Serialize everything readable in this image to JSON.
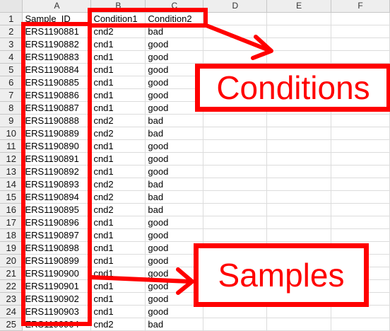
{
  "columns": [
    "A",
    "B",
    "C",
    "D",
    "E",
    "F"
  ],
  "header_row": [
    "Sample_ID",
    "Condition1",
    "Condition2",
    "",
    "",
    ""
  ],
  "rows": [
    {
      "n": "2",
      "a": "ERS1190881",
      "b": "cnd2",
      "c": "bad"
    },
    {
      "n": "3",
      "a": "ERS1190882",
      "b": "cnd1",
      "c": "good"
    },
    {
      "n": "4",
      "a": "ERS1190883",
      "b": "cnd1",
      "c": "good"
    },
    {
      "n": "5",
      "a": "ERS1190884",
      "b": "cnd1",
      "c": "good"
    },
    {
      "n": "6",
      "a": "ERS1190885",
      "b": "cnd1",
      "c": "good"
    },
    {
      "n": "7",
      "a": "ERS1190886",
      "b": "cnd1",
      "c": "good"
    },
    {
      "n": "8",
      "a": "ERS1190887",
      "b": "cnd1",
      "c": "good"
    },
    {
      "n": "9",
      "a": "ERS1190888",
      "b": "cnd2",
      "c": "bad"
    },
    {
      "n": "10",
      "a": "ERS1190889",
      "b": "cnd2",
      "c": "bad"
    },
    {
      "n": "11",
      "a": "ERS1190890",
      "b": "cnd1",
      "c": "good"
    },
    {
      "n": "12",
      "a": "ERS1190891",
      "b": "cnd1",
      "c": "good"
    },
    {
      "n": "13",
      "a": "ERS1190892",
      "b": "cnd1",
      "c": "good"
    },
    {
      "n": "14",
      "a": "ERS1190893",
      "b": "cnd2",
      "c": "bad"
    },
    {
      "n": "15",
      "a": "ERS1190894",
      "b": "cnd2",
      "c": "bad"
    },
    {
      "n": "16",
      "a": "ERS1190895",
      "b": "cnd2",
      "c": "bad"
    },
    {
      "n": "17",
      "a": "ERS1190896",
      "b": "cnd1",
      "c": "good"
    },
    {
      "n": "18",
      "a": "ERS1190897",
      "b": "cnd1",
      "c": "good"
    },
    {
      "n": "19",
      "a": "ERS1190898",
      "b": "cnd1",
      "c": "good"
    },
    {
      "n": "20",
      "a": "ERS1190899",
      "b": "cnd1",
      "c": "good"
    },
    {
      "n": "21",
      "a": "ERS1190900",
      "b": "cnd1",
      "c": "good"
    },
    {
      "n": "22",
      "a": "ERS1190901",
      "b": "cnd1",
      "c": "good"
    },
    {
      "n": "23",
      "a": "ERS1190902",
      "b": "cnd1",
      "c": "good"
    },
    {
      "n": "24",
      "a": "ERS1190903",
      "b": "cnd1",
      "c": "good"
    },
    {
      "n": "25",
      "a": "ERS1190904",
      "b": "cnd2",
      "c": "bad"
    }
  ],
  "annotations": {
    "conditions_label": "Conditions",
    "samples_label": "Samples",
    "highlight_color": "#ff0000"
  }
}
